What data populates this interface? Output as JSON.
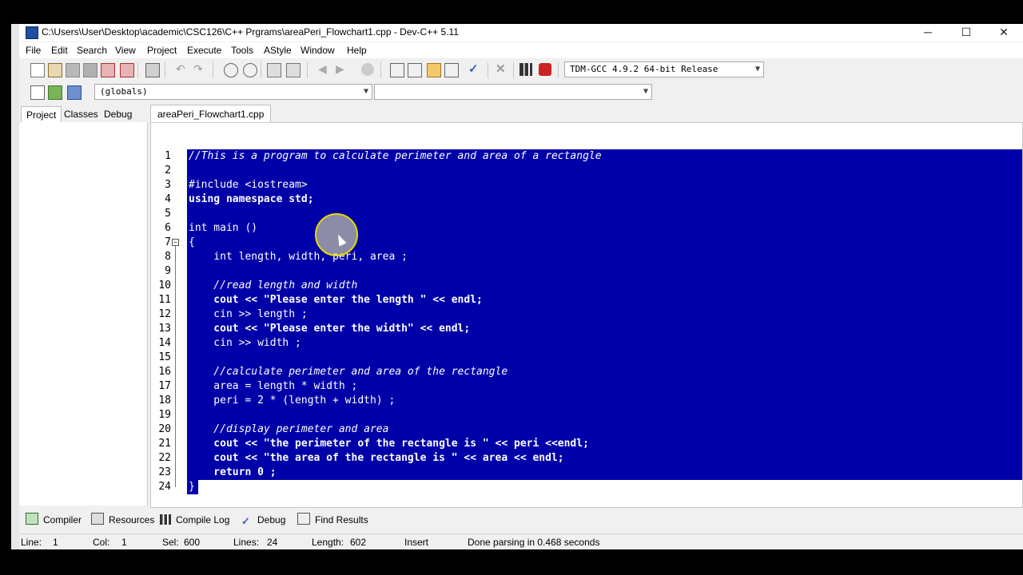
{
  "window": {
    "title": "C:\\Users\\User\\Desktop\\academic\\CSC126\\C++ Prgrams\\areaPeri_Flowchart1.cpp - Dev-C++ 5.11",
    "minimize": "─",
    "maximize": "☐",
    "close": "✕"
  },
  "menu": [
    "File",
    "Edit",
    "Search",
    "View",
    "Project",
    "Execute",
    "Tools",
    "AStyle",
    "Window",
    "Help"
  ],
  "toolbar": {
    "compiler_select": "TDM-GCC 4.9.2 64-bit Release",
    "globals_select": "(globals)",
    "members_select": ""
  },
  "left_tabs": [
    "Project",
    "Classes",
    "Debug"
  ],
  "editor": {
    "file_tab": "areaPeri_Flowchart1.cpp",
    "lines": [
      {
        "n": "1",
        "text": "//This is a program to calculate perimeter and area of a rectangle"
      },
      {
        "n": "2",
        "text": ""
      },
      {
        "n": "3",
        "text": "#include <iostream>"
      },
      {
        "n": "4",
        "text": "using namespace std;"
      },
      {
        "n": "5",
        "text": ""
      },
      {
        "n": "6",
        "text": "int main ()"
      },
      {
        "n": "7",
        "text": "{"
      },
      {
        "n": "8",
        "text": "    int length, width, peri, area ;"
      },
      {
        "n": "9",
        "text": ""
      },
      {
        "n": "10",
        "text": "    //read length and width"
      },
      {
        "n": "11",
        "text": "    cout << \"Please enter the length \" << endl;"
      },
      {
        "n": "12",
        "text": "    cin >> length ;"
      },
      {
        "n": "13",
        "text": "    cout << \"Please enter the width\" << endl;"
      },
      {
        "n": "14",
        "text": "    cin >> width ;"
      },
      {
        "n": "15",
        "text": ""
      },
      {
        "n": "16",
        "text": "    //calculate perimeter and area of the rectangle"
      },
      {
        "n": "17",
        "text": "    area = length * width ;"
      },
      {
        "n": "18",
        "text": "    peri = 2 * (length + width) ;"
      },
      {
        "n": "19",
        "text": ""
      },
      {
        "n": "20",
        "text": "    //display perimeter and area"
      },
      {
        "n": "21",
        "text": "    cout << \"the perimeter of the rectangle is \" << peri <<endl;"
      },
      {
        "n": "22",
        "text": "    cout << \"the area of the rectangle is \" << area << endl;"
      },
      {
        "n": "23",
        "text": "    return 0 ;"
      },
      {
        "n": "24",
        "text": "}"
      }
    ]
  },
  "bottom_tabs": [
    "Compiler",
    "Resources",
    "Compile Log",
    "Debug",
    "Find Results"
  ],
  "status": {
    "line_label": "Line:",
    "line_value": "1",
    "col_label": "Col:",
    "col_value": "1",
    "sel_label": "Sel:",
    "sel_value": "600",
    "lines_label": "Lines:",
    "lines_value": "24",
    "length_label": "Length:",
    "length_value": "602",
    "mode": "Insert",
    "message": "Done parsing in 0.468 seconds"
  },
  "colors": {
    "selection_bg": "#0000a8",
    "selection_fg": "#ffffff"
  }
}
